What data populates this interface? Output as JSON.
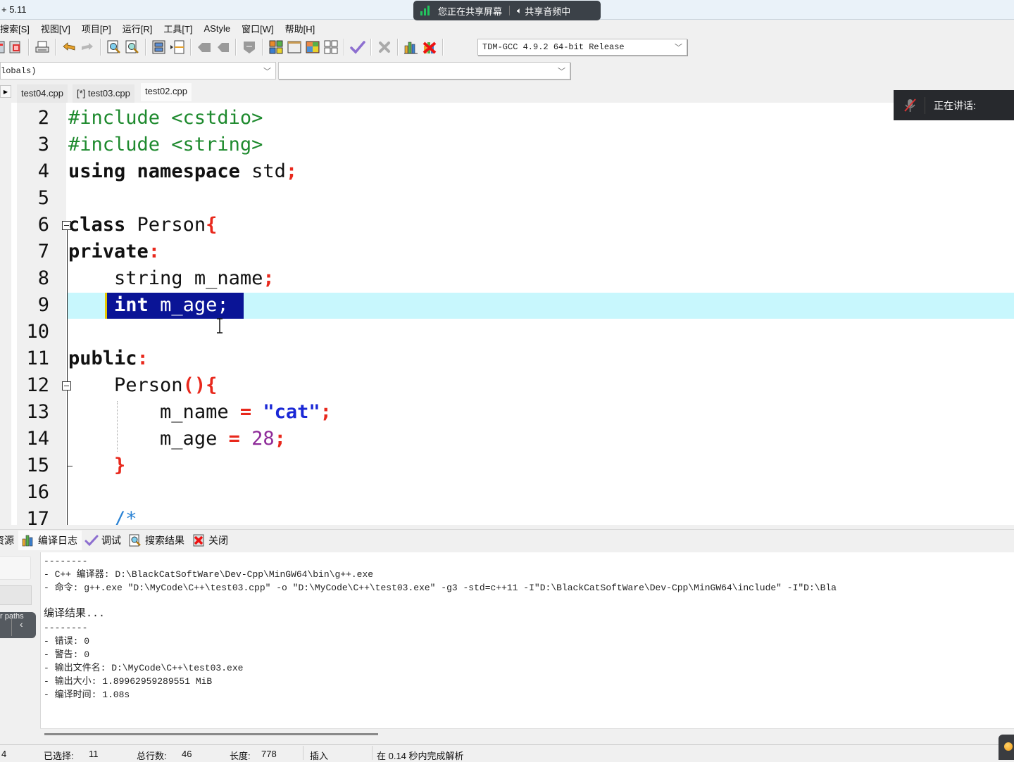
{
  "window": {
    "title": "+ 5.11"
  },
  "share_banner": {
    "sharing_text": "您正在共享屏幕",
    "audio_text": "共享音频中",
    "accent": "#22c55e"
  },
  "menu": {
    "items": [
      "搜索[S]",
      "视图[V]",
      "项目[P]",
      "运行[R]",
      "工具[T]",
      "AStyle",
      "窗口[W]",
      "帮助[H]"
    ]
  },
  "toolbar": {
    "compiler": "TDM-GCC 4.9.2 64-bit Release"
  },
  "scope": {
    "class_value": "lobals)",
    "member_value": ""
  },
  "file_tabs": [
    {
      "label": "test04.cpp",
      "active": false
    },
    {
      "label": "[*] test03.cpp",
      "active": false
    },
    {
      "label": "test02.cpp",
      "active": true
    }
  ],
  "editor": {
    "line_numbers": [
      "2",
      "3",
      "4",
      "5",
      "6",
      "7",
      "8",
      "9",
      "10",
      "11",
      "12",
      "13",
      "14",
      "15",
      "16",
      "17"
    ],
    "lines": {
      "l2": {
        "text": "#include <cstdio>"
      },
      "l3": {
        "text": "#include <string>"
      },
      "l4": {
        "kw1": "using",
        "kw2": "namespace",
        "id": "std",
        "punct": ";"
      },
      "l6": {
        "kw": "class",
        "id": "Person",
        "punct": "{"
      },
      "l7": {
        "kw": "private",
        "punct": ":"
      },
      "l8": {
        "id": "string m_name",
        "punct": ";"
      },
      "l9": {
        "kw": "int",
        "id": "m_age;"
      },
      "l11": {
        "kw": "public",
        "punct": ":"
      },
      "l12": {
        "id": "Person",
        "punct": "(){"
      },
      "l13": {
        "id": "m_name",
        "op": "=",
        "str": "\"cat\"",
        "punct": ";"
      },
      "l14": {
        "id": "m_age",
        "op": "=",
        "num": "28",
        "punct": ";"
      },
      "l15": {
        "punct": "}"
      },
      "l17": {
        "comment": "/*"
      }
    },
    "selected_line": "9",
    "selection_text": "int m_age;"
  },
  "speaking_indicator": {
    "label": "正在讲话:"
  },
  "bottom_tabs": [
    {
      "label": "资源",
      "icon": "resources-icon"
    },
    {
      "label": "编译日志",
      "icon": "bar-chart-icon",
      "active": true
    },
    {
      "label": "调试",
      "icon": "check-icon"
    },
    {
      "label": "搜索结果",
      "icon": "search-doc-icon"
    },
    {
      "label": "关闭",
      "icon": "close-doc-icon"
    }
  ],
  "side_panel": {
    "paths_label": "r paths",
    "collapse_glyph": "‹"
  },
  "compile_log": {
    "lines": [
      "--------",
      "- C++ 编译器: D:\\BlackCatSoftWare\\Dev-Cpp\\MinGW64\\bin\\g++.exe",
      "- 命令: g++.exe \"D:\\MyCode\\C++\\test03.cpp\" -o \"D:\\MyCode\\C++\\test03.exe\" -g3 -std=c++11 -I\"D:\\BlackCatSoftWare\\Dev-Cpp\\MinGW64\\include\" -I\"D:\\Bla",
      "",
      "编译结果...",
      "--------",
      "- 错误: 0",
      "- 警告: 0",
      "- 输出文件名: D:\\MyCode\\C++\\test03.exe",
      "- 输出大小: 1.89962959289551 MiB",
      "- 编译时间: 1.08s"
    ]
  },
  "status_bar": {
    "col": "4",
    "selected_label": "已选择:",
    "selected_value": "11",
    "lines_label": "总行数:",
    "lines_value": "46",
    "length_label": "长度:",
    "length_value": "778",
    "mode": "插入",
    "parse_message": "在 0.14 秒内完成解析"
  }
}
